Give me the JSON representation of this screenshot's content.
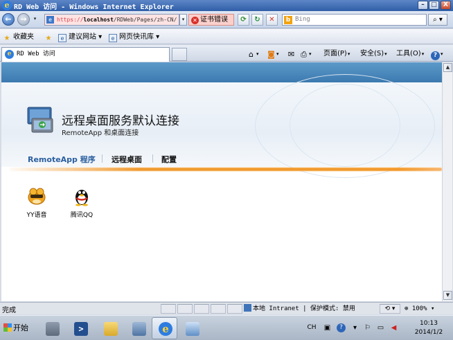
{
  "window": {
    "title": "RD Web 访问 - Windows Internet Explorer",
    "min_label": "–",
    "max_label": "□",
    "close_label": "X"
  },
  "address_bar": {
    "url_scheme": "https://",
    "url_host": "localhost",
    "url_path": "/RDWeb/Pages/zh-CN/",
    "cert_error": "证书错误",
    "search_placeholder": "Bing",
    "search_button_label": "⌕ ▾"
  },
  "favorites_bar": {
    "favorites_label": "收藏夹",
    "items": [
      "建议网站 ▾",
      "网页快讯库 ▾"
    ]
  },
  "tab": {
    "title": "RD Web 访问"
  },
  "command_bar": {
    "page_label": "页面(P)",
    "safety_label": "安全(S)",
    "tools_label": "工具(O)",
    "help_label": "?"
  },
  "page": {
    "title": "远程桌面服务默认连接",
    "subtitle": "RemoteApp 和桌面连接",
    "nav": [
      {
        "label": "RemoteApp 程序",
        "active": true
      },
      {
        "label": "远程桌面",
        "active": false
      },
      {
        "label": "配置",
        "active": false
      }
    ],
    "apps": [
      {
        "label": "YY语音",
        "icon": "yy-voice-icon"
      },
      {
        "label": "腾讯QQ",
        "icon": "qq-penguin-icon"
      }
    ]
  },
  "status_bar": {
    "status": "完成",
    "zone": "本地 Intranet | 保护模式: 禁用",
    "zoom": "100%"
  },
  "taskbar": {
    "start_label": "开始",
    "language": "CH",
    "time": "10:13",
    "date": "2014/1/2"
  },
  "colors": {
    "accent_blue": "#2a5f9e",
    "orange_line": "#f09a2f",
    "cert_error_bg": "#fbd0cc"
  }
}
